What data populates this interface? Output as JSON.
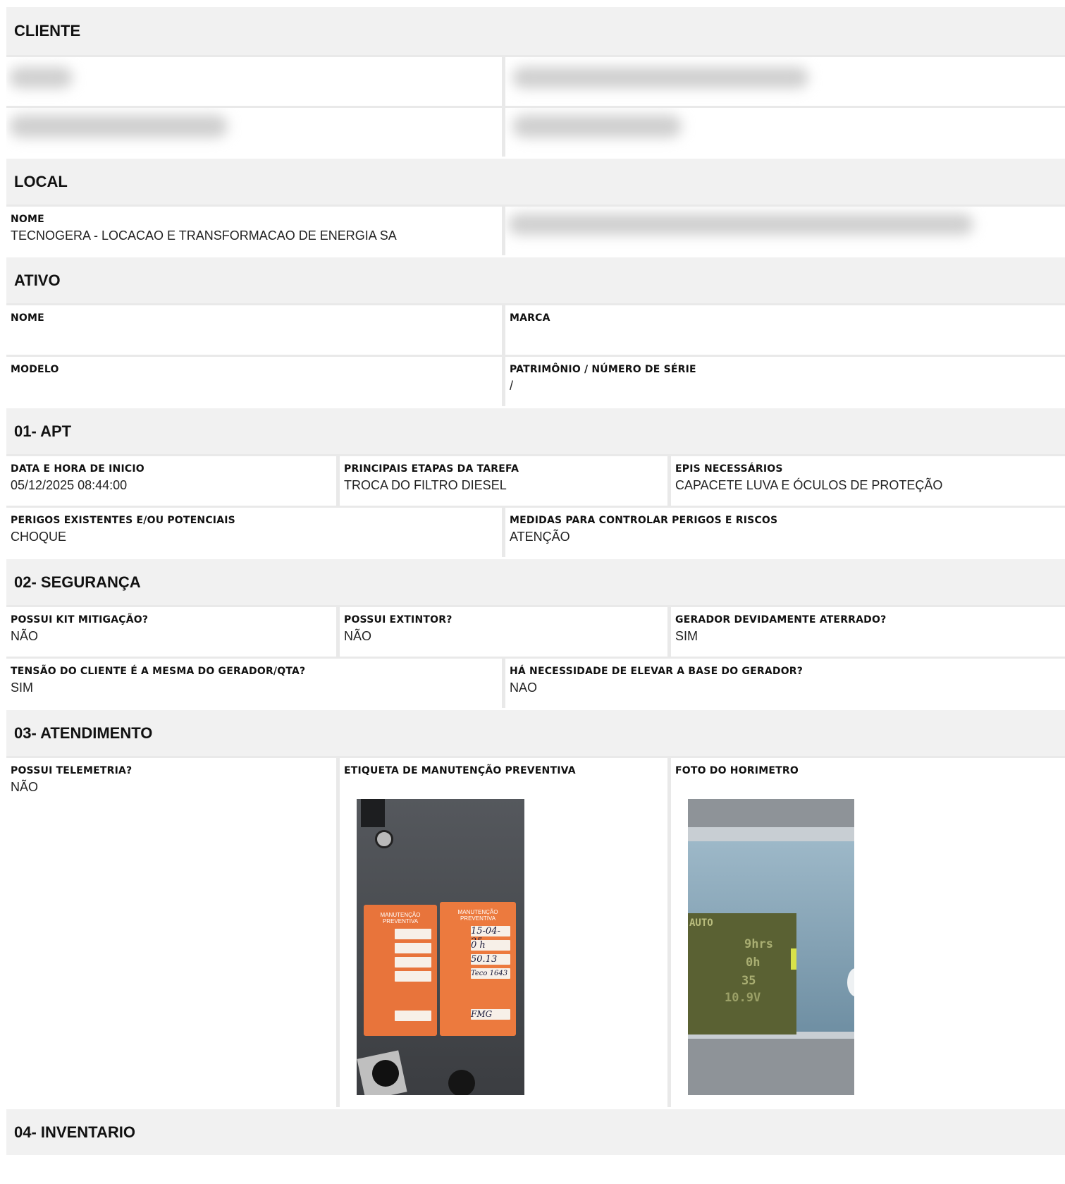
{
  "sections": {
    "cliente": "CLIENTE",
    "local": "LOCAL",
    "ativo": "ATIVO",
    "apt": "01- APT",
    "seguranca": "02- SEGURANÇA",
    "atendimento": "03- ATENDIMENTO",
    "inventario": "04- INVENTARIO"
  },
  "local": {
    "nome_label": "NOME",
    "nome_value": "TECNOGERA - LOCACAO E TRANSFORMACAO DE ENERGIA SA"
  },
  "ativo": {
    "nome_label": "NOME",
    "nome_value": "",
    "marca_label": "MARCA",
    "marca_value": "",
    "modelo_label": "MODELO",
    "modelo_value": "",
    "patrimonio_label": "PATRIMÔNIO / NÚMERO DE SÉRIE",
    "patrimonio_value": "/"
  },
  "apt": {
    "inicio_label": "DATA E HORA DE INICIO",
    "inicio_value": "05/12/2025 08:44:00",
    "etapas_label": "PRINCIPAIS ETAPAS DA TAREFA",
    "etapas_value": "TROCA DO FILTRO DIESEL",
    "epis_label": "EPIS NECESSÁRIOS",
    "epis_value": "CAPACETE LUVA E ÓCULOS DE PROTEÇÃO",
    "perigos_label": "PERIGOS EXISTENTES E/OU POTENCIAIS",
    "perigos_value": "CHOQUE",
    "medidas_label": "MEDIDAS PARA CONTROLAR PERIGOS E RISCOS",
    "medidas_value": "ATENÇÃO"
  },
  "seguranca": {
    "kit_label": "POSSUI KIT MITIGAÇÃO?",
    "kit_value": "NÃO",
    "extintor_label": "POSSUI EXTINTOR?",
    "extintor_value": "NÃO",
    "aterrado_label": "GERADOR DEVIDAMENTE ATERRADO?",
    "aterrado_value": "SIM",
    "tensao_label": "TENSÃO DO CLIENTE É A MESMA DO GERADOR/QTA?",
    "tensao_value": "SIM",
    "base_label": "HÁ NECESSIDADE DE ELEVAR A BASE DO GERADOR?",
    "base_value": "NAO"
  },
  "atendimento": {
    "telemetria_label": "POSSUI TELEMETRIA?",
    "telemetria_value": "NÃO",
    "etiqueta_label": "ETIQUETA DE MANUTENÇÃO PREVENTIVA",
    "horimetro_label": "FOTO DO HORIMETRO"
  },
  "photos": {
    "tag_title": "MANUTENÇÃO PREVENTIVA",
    "tag_date": "15-04-25",
    "tag_hours": "0 h",
    "tag_plan": "50.13",
    "tag_patrimonio": "Teco 1643",
    "tag_responsavel": "FMG",
    "display_mode": "AUTO",
    "display_line1": "9hrs",
    "display_line2": "0h",
    "display_line3": "35",
    "display_line4": "10.9V"
  },
  "colors": {
    "header_bg": "#f1f1f1",
    "divider": "#e9e9e9",
    "tag_orange": "#e8743b",
    "panel_gray": "#4a4d52"
  }
}
